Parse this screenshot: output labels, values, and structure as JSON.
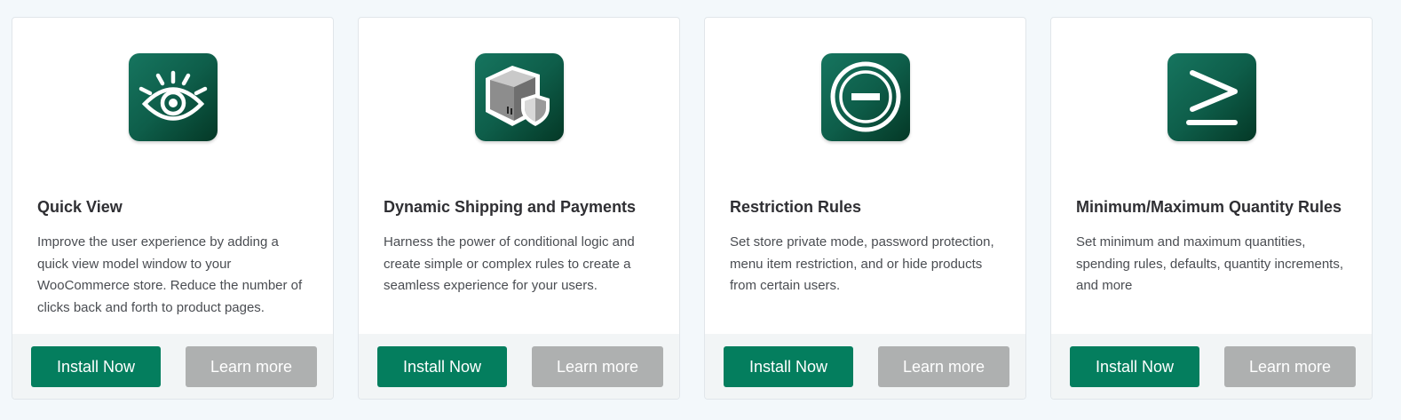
{
  "colors": {
    "page_background": "#f3f8fb",
    "install_button": "#047e5e",
    "learn_button": "#aeb0b0",
    "icon_gradient_start": "#16755f",
    "icon_gradient_end": "#043826"
  },
  "cards": [
    {
      "icon": "eye-icon",
      "title": "Quick View",
      "description": "Improve the user experience by adding a quick view model window to your WooCommerce store. Reduce the number of clicks back and forth to product pages.",
      "install_label": "Install Now",
      "learn_label": "Learn more"
    },
    {
      "icon": "shipping-box-shield-icon",
      "title": "Dynamic Shipping and Payments",
      "description": "Harness the power of conditional logic and create simple or complex rules to create a seamless experience for your users.",
      "install_label": "Install Now",
      "learn_label": "Learn more"
    },
    {
      "icon": "restriction-minus-circle-icon",
      "title": "Restriction Rules",
      "description": "Set store private mode, password protection, menu item restriction, and or hide products from certain users.",
      "install_label": "Install Now",
      "learn_label": "Learn more"
    },
    {
      "icon": "greater-than-or-equal-icon",
      "title": "Minimum/Maximum Quantity Rules",
      "description": "Set minimum and maximum quantities, spending rules, defaults, quantity increments, and more",
      "install_label": "Install Now",
      "learn_label": "Learn more"
    }
  ]
}
